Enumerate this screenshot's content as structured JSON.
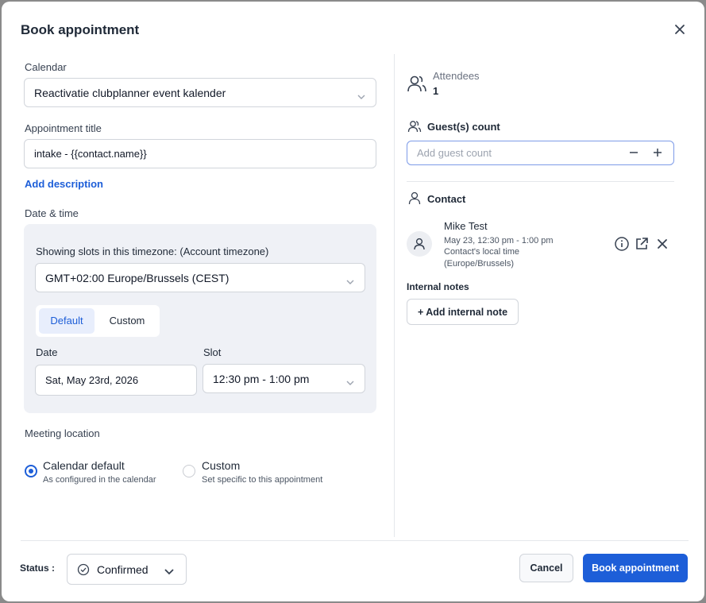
{
  "dialog": {
    "title": "Book appointment"
  },
  "calendar": {
    "label": "Calendar",
    "value": "Reactivatie clubplanner event kalender"
  },
  "appointment_title": {
    "label": "Appointment title",
    "value": "intake - {{contact.name}}"
  },
  "add_description": "Add description",
  "datetime": {
    "label": "Date & time",
    "timezone_label": "Showing slots in this timezone: (Account timezone)",
    "timezone_value": "GMT+02:00 Europe/Brussels (CEST)",
    "tabs": [
      "Default",
      "Custom"
    ],
    "active_tab": "Default",
    "date_label": "Date",
    "date_value": "Sat, May 23rd, 2026",
    "slot_label": "Slot",
    "slot_value": "12:30 pm - 1:00 pm"
  },
  "meeting_location": {
    "label": "Meeting location",
    "options": [
      {
        "title": "Calendar default",
        "subtitle": "As configured in the calendar",
        "selected": true
      },
      {
        "title": "Custom",
        "subtitle": "Set specific to this appointment",
        "selected": false
      }
    ]
  },
  "attendees": {
    "label": "Attendees",
    "count": "1"
  },
  "guests": {
    "label": "Guest(s) count",
    "placeholder": "Add guest count"
  },
  "contact": {
    "label": "Contact",
    "name": "Mike Test",
    "time": "May 23, 12:30 pm - 1:00 pm",
    "local_time_label": "Contact's local time",
    "local_tz": "(Europe/Brussels)"
  },
  "internal_notes": {
    "label": "Internal notes",
    "add_button": "+ Add internal note"
  },
  "footer": {
    "status_label": "Status :",
    "status_value": "Confirmed",
    "cancel": "Cancel",
    "book": "Book appointment"
  },
  "colors": {
    "accent": "#1d5ed8",
    "panel": "#eff1f6",
    "border": "#d1d5db"
  },
  "icons": [
    "close-icon",
    "chevron-down-icon",
    "users-icon",
    "user-icon",
    "minus-icon",
    "plus-icon",
    "info-icon",
    "external-link-icon",
    "check-circle-icon"
  ]
}
